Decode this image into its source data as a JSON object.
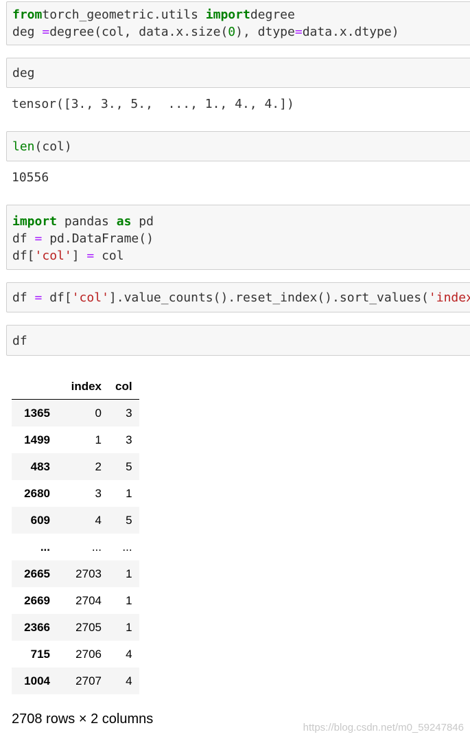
{
  "cells": [
    {
      "lines": [
        [
          [
            "kw",
            "from"
          ],
          [
            "",
            "torch_geometric.utils "
          ],
          [
            "kw",
            "import"
          ],
          [
            "",
            "degree"
          ]
        ],
        [
          [
            "",
            "deg "
          ],
          [
            "op",
            "="
          ],
          [
            "",
            "degree(col, data.x.size("
          ],
          [
            "num",
            "0"
          ],
          [
            "",
            "), dtype"
          ],
          [
            "op",
            "="
          ],
          [
            "",
            "data.x.dtype)"
          ]
        ]
      ],
      "output": "tensor([3., 3., 5.,  ..., 1., 4., 4.])"
    },
    {
      "lines": [
        [
          [
            "",
            "deg"
          ]
        ]
      ],
      "output": "tensor([3., 3., 5.,  ..., 1., 4., 4.])"
    },
    {
      "lines": [
        [
          [
            "fn",
            "len"
          ],
          [
            "",
            "(col)"
          ]
        ]
      ],
      "output": "10556"
    },
    {
      "lines": [
        [
          [
            "kw",
            "import"
          ],
          [
            "",
            " pandas "
          ],
          [
            "kw",
            "as"
          ],
          [
            "",
            " pd"
          ]
        ],
        [
          [
            "",
            "df "
          ],
          [
            "op",
            "="
          ],
          [
            "",
            " pd.DataFrame()"
          ]
        ],
        [
          [
            "",
            "df["
          ],
          [
            "str",
            "'col'"
          ],
          [
            "",
            "] "
          ],
          [
            "op",
            "="
          ],
          [
            "",
            " col"
          ]
        ]
      ]
    },
    {
      "lines": [
        [
          [
            "",
            "df "
          ],
          [
            "op",
            "="
          ],
          [
            "",
            " df["
          ],
          [
            "str",
            "'col'"
          ],
          [
            "",
            "].value_counts().reset_index().sort_values("
          ],
          [
            "str",
            "'index'"
          ],
          [
            "",
            ")"
          ]
        ]
      ]
    },
    {
      "lines": [
        [
          [
            "",
            "df"
          ]
        ]
      ]
    }
  ],
  "outputs": {
    "deg": "tensor([3., 3., 5.,  ..., 1., 4., 4.])",
    "len": "10556"
  },
  "dataframe": {
    "columns": [
      "",
      "index",
      "col"
    ],
    "rows": [
      [
        "1365",
        "0",
        "3"
      ],
      [
        "1499",
        "1",
        "3"
      ],
      [
        "483",
        "2",
        "5"
      ],
      [
        "2680",
        "3",
        "1"
      ],
      [
        "609",
        "4",
        "5"
      ],
      [
        "...",
        "...",
        "..."
      ],
      [
        "2665",
        "2703",
        "1"
      ],
      [
        "2669",
        "2704",
        "1"
      ],
      [
        "2366",
        "2705",
        "1"
      ],
      [
        "715",
        "2706",
        "4"
      ],
      [
        "1004",
        "2707",
        "4"
      ]
    ],
    "shape": "2708 rows × 2 columns"
  },
  "watermark": "https://blog.csdn.net/m0_59247846"
}
